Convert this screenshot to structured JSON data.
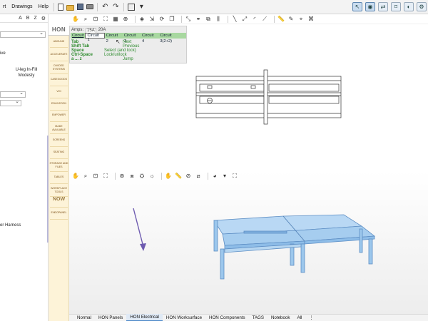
{
  "menubar": {
    "items": [
      "rt",
      "Drawings",
      "Help"
    ]
  },
  "left_panel": {
    "tool_letters": [
      "A",
      "B",
      "Z"
    ],
    "texts": {
      "ive": "ive",
      "product_name": "U-leg In-Fill",
      "product_sub": "Modesty",
      "harness": "er Harness"
    }
  },
  "category_strip": {
    "logo": "HON",
    "categories": [
      "ABOUND",
      "ACCELERATE",
      "DIVIDED SYSTEMS",
      "CASEGOODS",
      "VOI",
      "EDUCATION",
      "EMPOWER",
      "MADE AVAILABLE",
      "SCREENS",
      "SEATING",
      "STORAGE AND FILES",
      "TABLES",
      "WORKPLACE TOOLS",
      "NOW",
      "ENDOPANEL"
    ]
  },
  "amps_panel": {
    "amps_label": "Amps:",
    "amps_options": [
      "15A",
      "20A"
    ],
    "circuit_label": "Circuit",
    "circuits": [
      "Circuit 1",
      "Circuit 2",
      "Circuit 3",
      "Circuit 4",
      "Circuit 3(2+2)"
    ],
    "selected_circuit": "Circuit 1",
    "shortcuts": [
      {
        "key": "Tab",
        "action": "Next"
      },
      {
        "key": "Shift Tab",
        "action": "Previous"
      },
      {
        "key": "Space",
        "action": "Select (and lock)"
      },
      {
        "key": "Ctrl-Space",
        "action": "Lock/unlock"
      },
      {
        "key": "a ... z",
        "action": "Jump"
      }
    ]
  },
  "bottom_tabs": {
    "items": [
      "Normal",
      "HON Panels",
      "HON Electrical",
      "HON Worksurface",
      "HON Components",
      "TAGS",
      "Notebook",
      "All",
      "⋮"
    ],
    "active": "HON Electrical"
  },
  "colors": {
    "table_fill": "#a6cdef",
    "table_edge": "#5d8ec4",
    "arrow": "#6e5bb0",
    "shortcut_green": "#2c8a2c",
    "circuit_bar": "#a8d8a0"
  },
  "icons": {
    "menubar": [
      "new-doc-icon",
      "open-folder-icon",
      "save-icon",
      "print-icon",
      "undo-icon",
      "redo-icon",
      "view-layout-icon"
    ],
    "top_toolbar": [
      "hand-pan-icon",
      "zoom-icon",
      "zoom-window-icon",
      "zoom-fit-icon",
      "grid-icon",
      "snap-icon"
    ],
    "view3d_toolbar": [
      "hand-pan-icon",
      "zoom-icon",
      "zoom-window-icon",
      "zoom-fit-icon",
      "orbit-icon",
      "view-cube-icon",
      "camera-icon"
    ]
  }
}
